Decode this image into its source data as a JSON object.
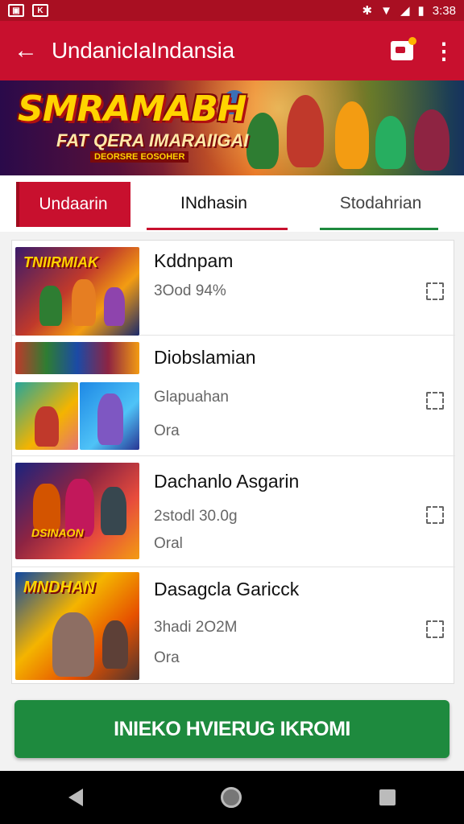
{
  "status_bar": {
    "time": "3:38",
    "battery_label": "▮"
  },
  "app_bar": {
    "title": "UndanicIaIndansia"
  },
  "hero": {
    "title": "SMRAMABH",
    "subtitle": "FAT QERA IMARAIIGAI",
    "tag": "DEORSRE EOSOHER"
  },
  "tabs": [
    {
      "label": "Undaarin"
    },
    {
      "label": "INdhasin"
    },
    {
      "label": "Stodahrian"
    }
  ],
  "thumbs": {
    "t1": "TNIIRMIAK",
    "t3": "DSINAON",
    "t4": "MNDHAN"
  },
  "items": [
    {
      "title": "Kddnpam",
      "meta": "3Ood 94%",
      "sub": ""
    },
    {
      "title": "Diobslamian",
      "meta": "Glapuahan",
      "sub": "Ora"
    },
    {
      "title": "Dachanlo Asgarin",
      "meta": "2stodl 30.0g",
      "sub": "Oral"
    },
    {
      "title": "Dasagcla Garicck",
      "meta": "3hadi 2O2M",
      "sub": "Ora"
    }
  ],
  "cta": {
    "label": "INIEKO HVIERUG IKROMI"
  },
  "colors": {
    "primary": "#c8102e",
    "accent_green": "#1e8a3e"
  },
  "icons": [
    "back-arrow-icon",
    "cast-icon",
    "more-vert-icon",
    "download-icon",
    "nav-back-icon",
    "nav-home-icon",
    "nav-recent-icon"
  ]
}
